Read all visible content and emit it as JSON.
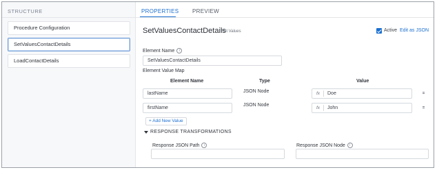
{
  "structure": {
    "heading": "STRUCTURE",
    "items": [
      {
        "label": "Procedure Configuration"
      },
      {
        "label": "SetValuesContactDetails"
      },
      {
        "label": "LoadContactDetails"
      }
    ],
    "selected_index": 1
  },
  "tabs": [
    {
      "label": "PROPERTIES"
    },
    {
      "label": "PREVIEW"
    }
  ],
  "active_tab": "PROPERTIES",
  "element": {
    "title": "SetValuesContactDetails",
    "type": "Set Values",
    "active_label": "Active",
    "active_checked": true,
    "edit_json_label": "Edit as JSON"
  },
  "form": {
    "element_name_label": "Element Name",
    "element_name_value": "SetValuesContactDetails",
    "value_map_label": "Element Value Map",
    "columns": {
      "name": "Element Name",
      "type": "Type",
      "value": "Value"
    },
    "rows": [
      {
        "name": "lastName",
        "type": "JSON Node",
        "fx": "fx",
        "value": "Doe"
      },
      {
        "name": "firstName",
        "type": "JSON Node",
        "fx": "fx",
        "value": "John"
      }
    ],
    "add_value_label": "+ Add New Value"
  },
  "response": {
    "section_title": "RESPONSE TRANSFORMATIONS",
    "json_path_label": "Response JSON Path",
    "json_path_value": "",
    "json_node_label": "Response JSON Node",
    "json_node_value": ""
  },
  "colors": {
    "accent": "#1b6fd0",
    "border": "#d5d9de",
    "selected_border": "#6e9bd6"
  }
}
